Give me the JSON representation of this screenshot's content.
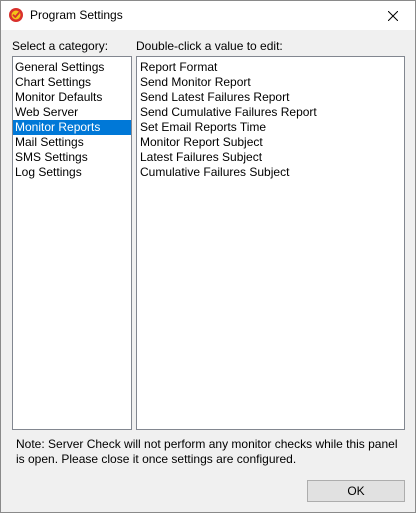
{
  "window": {
    "title": "Program Settings",
    "app_icon": "server-check-icon",
    "close_icon": "close-icon"
  },
  "category_label": "Select a category:",
  "value_label": "Double-click a value to edit:",
  "categories": [
    {
      "label": "General Settings",
      "selected": false
    },
    {
      "label": "Chart Settings",
      "selected": false
    },
    {
      "label": "Monitor Defaults",
      "selected": false
    },
    {
      "label": "Web Server",
      "selected": false
    },
    {
      "label": "Monitor Reports",
      "selected": true
    },
    {
      "label": "Mail Settings",
      "selected": false
    },
    {
      "label": "SMS Settings",
      "selected": false
    },
    {
      "label": "Log Settings",
      "selected": false
    }
  ],
  "values": [
    "Report Format",
    "Send Monitor Report",
    "Send Latest Failures Report",
    "Send Cumulative Failures Report",
    "Set Email Reports Time",
    "Monitor Report Subject",
    "Latest Failures Subject",
    "Cumulative Failures Subject"
  ],
  "note": "Note: Server Check will not perform any monitor checks while this panel is open. Please close it once settings are configured.",
  "ok_label": "OK",
  "colors": {
    "selection": "#0078d7",
    "background": "#f0f0f0"
  }
}
